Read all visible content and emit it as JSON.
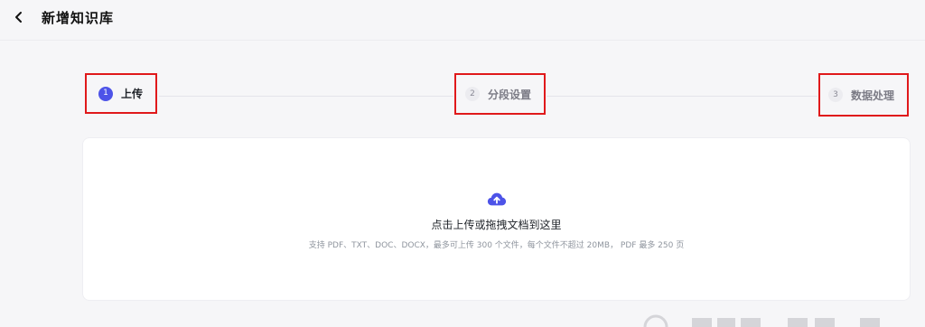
{
  "header": {
    "title": "新增知识库"
  },
  "steps": [
    {
      "number": "1",
      "label": "上传",
      "state": "active"
    },
    {
      "number": "2",
      "label": "分段设置",
      "state": "inactive"
    },
    {
      "number": "3",
      "label": "数据处理",
      "state": "inactive"
    }
  ],
  "upload": {
    "main_text": "点击上传或拖拽文档到这里",
    "hint_text": "支持 PDF、TXT、DOC、DOCX，最多可上传 300 个文件，每个文件不超过 20MB， PDF 最多 250 页"
  },
  "colors": {
    "accent": "#4d53e8",
    "highlight_box": "#e0191b",
    "background": "#f6f6f8"
  },
  "icons": {
    "back": "chevron-left-icon",
    "upload": "cloud-upload-icon"
  }
}
